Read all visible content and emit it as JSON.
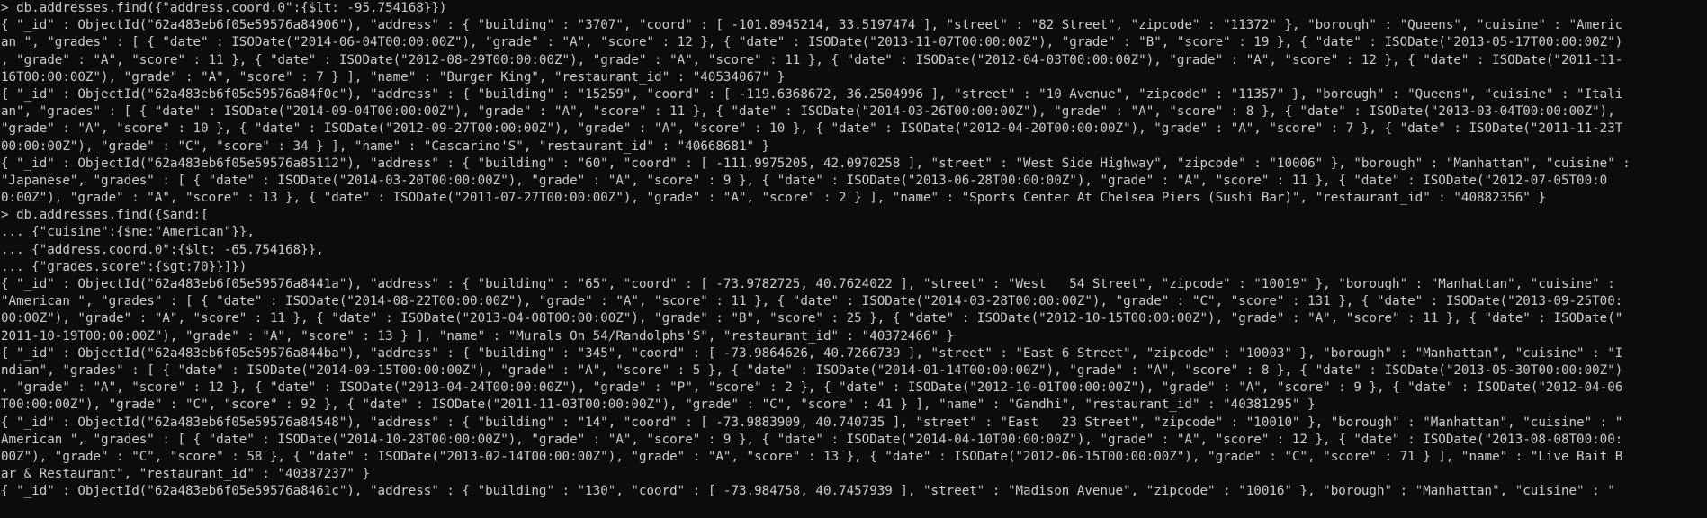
{
  "terminal": {
    "colors": {
      "background": "#0c0c0c",
      "foreground": "#cccccc"
    },
    "lines": [
      "> db.addresses.find({\"address.coord.0\":{$lt: -95.754168}})",
      "{ \"_id\" : ObjectId(\"62a483eb6f05e59576a84906\"), \"address\" : { \"building\" : \"3707\", \"coord\" : [ -101.8945214, 33.5197474 ], \"street\" : \"82 Street\", \"zipcode\" : \"11372\" }, \"borough\" : \"Queens\", \"cuisine\" : \"Americ",
      "an \", \"grades\" : [ { \"date\" : ISODate(\"2014-06-04T00:00:00Z\"), \"grade\" : \"A\", \"score\" : 12 }, { \"date\" : ISODate(\"2013-11-07T00:00:00Z\"), \"grade\" : \"B\", \"score\" : 19 }, { \"date\" : ISODate(\"2013-05-17T00:00:00Z\")",
      ", \"grade\" : \"A\", \"score\" : 11 }, { \"date\" : ISODate(\"2012-08-29T00:00:00Z\"), \"grade\" : \"A\", \"score\" : 11 }, { \"date\" : ISODate(\"2012-04-03T00:00:00Z\"), \"grade\" : \"A\", \"score\" : 12 }, { \"date\" : ISODate(\"2011-11-",
      "16T00:00:00Z\"), \"grade\" : \"A\", \"score\" : 7 } ], \"name\" : \"Burger King\", \"restaurant_id\" : \"40534067\" }",
      "{ \"_id\" : ObjectId(\"62a483eb6f05e59576a84f0c\"), \"address\" : { \"building\" : \"15259\", \"coord\" : [ -119.6368672, 36.2504996 ], \"street\" : \"10 Avenue\", \"zipcode\" : \"11357\" }, \"borough\" : \"Queens\", \"cuisine\" : \"Itali",
      "an\", \"grades\" : [ { \"date\" : ISODate(\"2014-09-04T00:00:00Z\"), \"grade\" : \"A\", \"score\" : 11 }, { \"date\" : ISODate(\"2014-03-26T00:00:00Z\"), \"grade\" : \"A\", \"score\" : 8 }, { \"date\" : ISODate(\"2013-03-04T00:00:00Z\"),",
      "\"grade\" : \"A\", \"score\" : 10 }, { \"date\" : ISODate(\"2012-09-27T00:00:00Z\"), \"grade\" : \"A\", \"score\" : 10 }, { \"date\" : ISODate(\"2012-04-20T00:00:00Z\"), \"grade\" : \"A\", \"score\" : 7 }, { \"date\" : ISODate(\"2011-11-23T",
      "00:00:00Z\"), \"grade\" : \"C\", \"score\" : 34 } ], \"name\" : \"Cascarino'S\", \"restaurant_id\" : \"40668681\" }",
      "{ \"_id\" : ObjectId(\"62a483eb6f05e59576a85112\"), \"address\" : { \"building\" : \"60\", \"coord\" : [ -111.9975205, 42.0970258 ], \"street\" : \"West Side Highway\", \"zipcode\" : \"10006\" }, \"borough\" : \"Manhattan\", \"cuisine\" :",
      "\"Japanese\", \"grades\" : [ { \"date\" : ISODate(\"2014-03-20T00:00:00Z\"), \"grade\" : \"A\", \"score\" : 9 }, { \"date\" : ISODate(\"2013-06-28T00:00:00Z\"), \"grade\" : \"A\", \"score\" : 11 }, { \"date\" : ISODate(\"2012-07-05T00:0",
      "0:00Z\"), \"grade\" : \"A\", \"score\" : 13 }, { \"date\" : ISODate(\"2011-07-27T00:00:00Z\"), \"grade\" : \"A\", \"score\" : 2 } ], \"name\" : \"Sports Center At Chelsea Piers (Sushi Bar)\", \"restaurant_id\" : \"40882356\" }",
      "> db.addresses.find({$and:[",
      "... {\"cuisine\":{$ne:\"American\"}},",
      "... {\"address.coord.0\":{$lt: -65.754168}},",
      "... {\"grades.score\":{$gt:70}}]})",
      "{ \"_id\" : ObjectId(\"62a483eb6f05e59576a8441a\"), \"address\" : { \"building\" : \"65\", \"coord\" : [ -73.9782725, 40.7624022 ], \"street\" : \"West   54 Street\", \"zipcode\" : \"10019\" }, \"borough\" : \"Manhattan\", \"cuisine\" :",
      "\"American \", \"grades\" : [ { \"date\" : ISODate(\"2014-08-22T00:00:00Z\"), \"grade\" : \"A\", \"score\" : 11 }, { \"date\" : ISODate(\"2014-03-28T00:00:00Z\"), \"grade\" : \"C\", \"score\" : 131 }, { \"date\" : ISODate(\"2013-09-25T00:",
      "00:00Z\"), \"grade\" : \"A\", \"score\" : 11 }, { \"date\" : ISODate(\"2013-04-08T00:00:00Z\"), \"grade\" : \"B\", \"score\" : 25 }, { \"date\" : ISODate(\"2012-10-15T00:00:00Z\"), \"grade\" : \"A\", \"score\" : 11 }, { \"date\" : ISODate(\"",
      "2011-10-19T00:00:00Z\"), \"grade\" : \"A\", \"score\" : 13 } ], \"name\" : \"Murals On 54/Randolphs'S\", \"restaurant_id\" : \"40372466\" }",
      "{ \"_id\" : ObjectId(\"62a483eb6f05e59576a844ba\"), \"address\" : { \"building\" : \"345\", \"coord\" : [ -73.9864626, 40.7266739 ], \"street\" : \"East 6 Street\", \"zipcode\" : \"10003\" }, \"borough\" : \"Manhattan\", \"cuisine\" : \"I",
      "ndian\", \"grades\" : [ { \"date\" : ISODate(\"2014-09-15T00:00:00Z\"), \"grade\" : \"A\", \"score\" : 5 }, { \"date\" : ISODate(\"2014-01-14T00:00:00Z\"), \"grade\" : \"A\", \"score\" : 8 }, { \"date\" : ISODate(\"2013-05-30T00:00:00Z\")",
      ", \"grade\" : \"A\", \"score\" : 12 }, { \"date\" : ISODate(\"2013-04-24T00:00:00Z\"), \"grade\" : \"P\", \"score\" : 2 }, { \"date\" : ISODate(\"2012-10-01T00:00:00Z\"), \"grade\" : \"A\", \"score\" : 9 }, { \"date\" : ISODate(\"2012-04-06",
      "T00:00:00Z\"), \"grade\" : \"C\", \"score\" : 92 }, { \"date\" : ISODate(\"2011-11-03T00:00:00Z\"), \"grade\" : \"C\", \"score\" : 41 } ], \"name\" : \"Gandhi\", \"restaurant_id\" : \"40381295\" }",
      "{ \"_id\" : ObjectId(\"62a483eb6f05e59576a84548\"), \"address\" : { \"building\" : \"14\", \"coord\" : [ -73.9883909, 40.740735 ], \"street\" : \"East   23 Street\", \"zipcode\" : \"10010\" }, \"borough\" : \"Manhattan\", \"cuisine\" : \"",
      "American \", \"grades\" : [ { \"date\" : ISODate(\"2014-10-28T00:00:00Z\"), \"grade\" : \"A\", \"score\" : 9 }, { \"date\" : ISODate(\"2014-04-10T00:00:00Z\"), \"grade\" : \"A\", \"score\" : 12 }, { \"date\" : ISODate(\"2013-08-08T00:00:",
      "00Z\"), \"grade\" : \"C\", \"score\" : 58 }, { \"date\" : ISODate(\"2013-02-14T00:00:00Z\"), \"grade\" : \"A\", \"score\" : 13 }, { \"date\" : ISODate(\"2012-06-15T00:00:00Z\"), \"grade\" : \"C\", \"score\" : 71 } ], \"name\" : \"Live Bait B",
      "ar & Restaurant\", \"restaurant_id\" : \"40387237\" }",
      "{ \"_id\" : ObjectId(\"62a483eb6f05e59576a8461c\"), \"address\" : { \"building\" : \"130\", \"coord\" : [ -73.984758, 40.7457939 ], \"street\" : \"Madison Avenue\", \"zipcode\" : \"10016\" }, \"borough\" : \"Manhattan\", \"cuisine\" : \""
    ]
  }
}
